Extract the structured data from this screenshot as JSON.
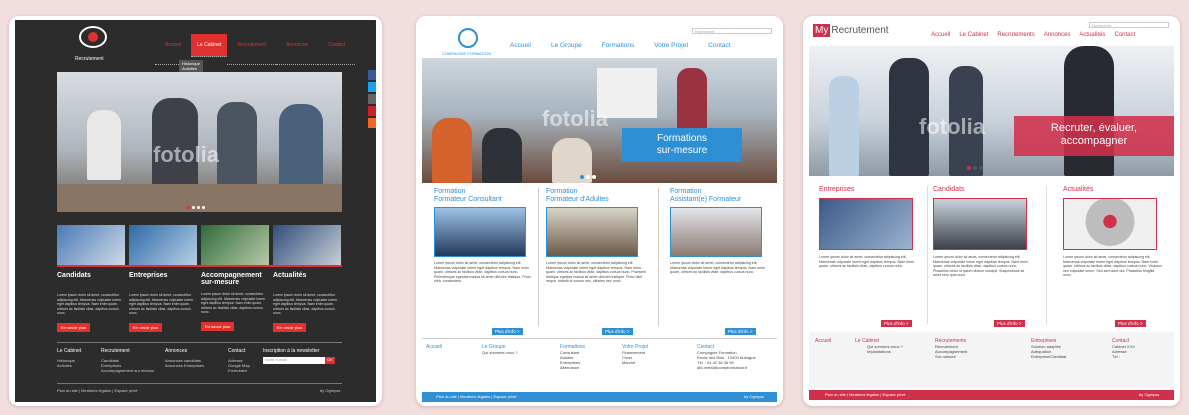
{
  "site1": {
    "logo_text": "Recrutement",
    "nav": [
      "Accueil",
      "Le Cabinet",
      "Recrutement",
      "Annonces",
      "Contact"
    ],
    "dropdown": [
      "Historique",
      "Activités"
    ],
    "watermark": "fotolia",
    "tiles": [
      {
        "title": "Candidats",
        "text": "Lorem ipsum dolor sit amet, consectetur adipiscing elit. Maecenas vulputate lorem eget dapibus tempus. Nam enim quam, ultrices ac facilisis vitae, dapibus cursus nunc.",
        "button": "En savoir plus"
      },
      {
        "title": "Entreprises",
        "text": "Lorem ipsum dolor sit amet, consectetur adipiscing elit. Maecenas vulputate lorem eget dapibus tempus. Nam enim quam, ultrices ac facilisis vitae, dapibus cursus nunc.",
        "button": "En savoir plus"
      },
      {
        "title": "Accompagnement sur-mesure",
        "text": "Lorem ipsum dolor sit amet, consectetur adipiscing elit. Maecenas vulputate lorem eget dapibus tempus. Nam enim quam, ultrices ac facilisis vitae, dapibus cursus nunc.",
        "button": "En savoir plus"
      },
      {
        "title": "Actualités",
        "text": "Lorem ipsum dolor sit amet, consectetur adipiscing elit. Maecenas vulputate lorem eget dapibus tempus. Nam enim quam, ultrices ac facilisis vitae, dapibus cursus nunc.",
        "button": "En savoir plus"
      }
    ],
    "footer_cols": [
      {
        "title": "Le Cabinet",
        "items": [
          "Historique",
          "Activités"
        ]
      },
      {
        "title": "Recrutement",
        "items": [
          "Candidats",
          "Entreprises",
          "Accompagnement sur mesure"
        ]
      },
      {
        "title": "Annonces",
        "items": [
          "Annonces candidats",
          "Annonces Entreprises"
        ]
      },
      {
        "title": "Contact",
        "items": [
          "Adresse",
          "Google Map",
          "Formulaire"
        ]
      }
    ],
    "newsletter_title": "Inscription à la newsletter",
    "newsletter_placeholder": "Votre e-mail",
    "newsletter_button": "OK",
    "footer_left": "Plan du site | Mentions légales | Espace privé",
    "footer_right": "by Ogmyos"
  },
  "site2": {
    "logo_text": "COMPAGNIE FORMATION",
    "search_placeholder": "Recherche",
    "nav": [
      "Accueil",
      "Le Groupe",
      "Formations",
      "Votre Projet",
      "Contact"
    ],
    "hero_caption": [
      "Formations",
      "sur-mesure"
    ],
    "watermark": "fotolia",
    "columns": [
      {
        "title": [
          "Formation",
          "Formateur Consultant"
        ],
        "text": "Lorem ipsum dolor sit amet, consectetur adipiscing elit. Maecenas vulputate lorem eget dapibus tempus. Nam enim quam, ultrices ac facilisis vitae, dapibus cursus nunc. Pellentesque egestas massa sit amet ultricies tristique. Proin nibh, consectetur",
        "button": "Plus d'info >"
      },
      {
        "title": [
          "Formation",
          "Formateur d'Adultes"
        ],
        "text": "Lorem ipsum dolor sit amet, consectetur adipiscing elit. Maecenas vulputate lorem eget dapibus tempus. Nam enim quam, ultrices ac facilisis vitae, dapibus cursus nunc. Praesent tristique egestas massa sit amet ultricies tristique. Proin nibh neque, blandit id cursus nec, ultricies nec nunc.",
        "button": "Plus d'info >"
      },
      {
        "title": [
          "Formation",
          "Assistant(e) Formateur"
        ],
        "text": "Lorem ipsum dolor sit amet, consectetur adipiscing elit. Maecenas vulputate lorem eget dapibus tempus. Nam enim quam, ultrices ac facilisis vitae, dapibus cursus nunc.",
        "button": "Plus d'info >"
      }
    ],
    "footer_cols": [
      {
        "title": "Accueil",
        "items": []
      },
      {
        "title": "Le Groupe",
        "items": [
          "Qui sommes nous ?"
        ]
      },
      {
        "title": "Formations",
        "items": [
          "Consultant",
          "Adultes",
          "Entreprises",
          "Alternance"
        ]
      },
      {
        "title": "Votre Projet",
        "items": [
          "Financement",
          "Choix",
          "Marché"
        ]
      },
      {
        "title": "Contact",
        "items": [
          "Compagnie Formation",
          "Route des Bois - 13400 Aubagne",
          "Tél. : 04 42 36 36 99",
          "abl-metal@compformation.fr"
        ]
      }
    ],
    "footer_bar": "Plan du site | Mentions légales | Espace privé",
    "footer_right": "by Ogmyos"
  },
  "site3": {
    "logo_badge": "My",
    "logo_text": "Recrutement",
    "search_placeholder": "Recherche",
    "nav": [
      "Accueil",
      "Le Cabinet",
      "Recrutements",
      "Annonces",
      "Actualités",
      "Contact"
    ],
    "hero_caption": [
      "Recruter, évaluer,",
      "accompagner"
    ],
    "watermark": "fotolia",
    "sections": [
      {
        "title": "Entreprises",
        "text": "Lorem ipsum dolor sit amet, consectetur adipiscing elit. Maecenas vulputate lorem eget dapibus tempus. Nam enim quam, ultrices ac facilisis vitae, dapibus cursus nunc.",
        "button": "Plus d'info >"
      },
      {
        "title": "Candidats",
        "text": "Lorem ipsum dolor sit amet, consectetur adipiscing elit. Maecenas vulputate lorem eget dapibus tempus. Nam enim quam, ultrices ac facilisis vitae, dapibus cursus nunc. Phasellus tortor ut ipsum dictum suscipit. Suspendisse sit amet sem quis nunc.",
        "button": "Plus d'info >"
      },
      {
        "title": "Actualités",
        "text": "Lorem ipsum dolor sit amet, consectetur adipiscing elit. Maecenas vulputate lorem eget dapibus tempus. Nam enim quam, ultrices ac facilisis vitae, dapibus cursus nunc. Vivamus nec vulputate lorem. Sed sed dolor dui. Phasellus fringilla nunc.",
        "button": "Plus d'info >"
      }
    ],
    "footer_cols": [
      {
        "title": "Accueil",
        "items": []
      },
      {
        "title": "Le Cabinet",
        "items": [
          "Qui sommes-nous ?",
          "Implantations"
        ]
      },
      {
        "title": "Recrutements",
        "items": [
          "Recrutement",
          "Accompagnement",
          "Sur-mesure"
        ]
      },
      {
        "title": "Entreprises",
        "items": [
          "Solution adaptée",
          "Adéquation",
          "Entreprise/Candidat"
        ]
      },
      {
        "title": "Contact",
        "items": [
          "Cabinet XXX",
          "Adresse",
          "Tél :"
        ]
      }
    ],
    "footer_bar": "Plan du site | Mentions légales | Espace privé",
    "footer_right": "by Ogmyos"
  }
}
